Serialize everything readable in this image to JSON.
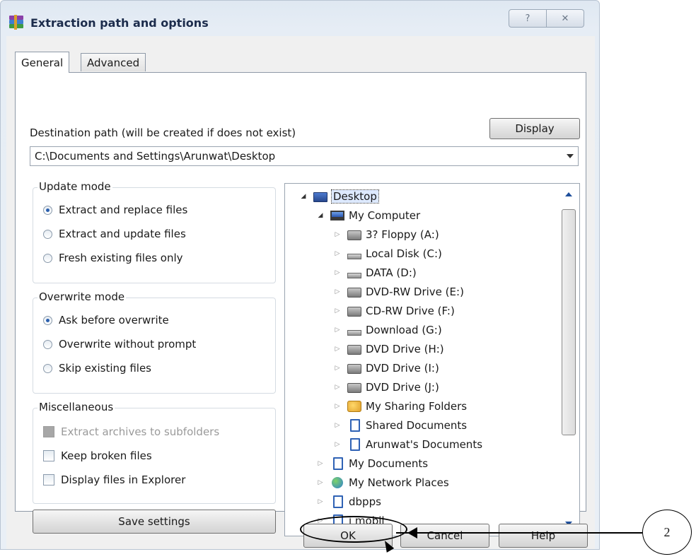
{
  "window": {
    "title": "Extraction path and options",
    "help_button": "?",
    "close_button": "✕"
  },
  "tabs": [
    {
      "label": "General",
      "selected": true
    },
    {
      "label": "Advanced",
      "selected": false
    }
  ],
  "destination": {
    "label": "Destination path (will be created if does not exist)",
    "display_button": "Display",
    "path_value": "C:\\Documents and Settings\\Arunwat\\Desktop"
  },
  "update_mode": {
    "title": "Update mode",
    "options": [
      {
        "label": "Extract and replace files",
        "selected": true
      },
      {
        "label": "Extract and update files",
        "selected": false
      },
      {
        "label": "Fresh existing files only",
        "selected": false
      }
    ]
  },
  "overwrite_mode": {
    "title": "Overwrite mode",
    "options": [
      {
        "label": "Ask before overwrite",
        "selected": true
      },
      {
        "label": "Overwrite without prompt",
        "selected": false
      },
      {
        "label": "Skip existing files",
        "selected": false
      }
    ]
  },
  "miscellaneous": {
    "title": "Miscellaneous",
    "options": [
      {
        "label": "Extract archives to subfolders",
        "enabled": false
      },
      {
        "label": "Keep broken files",
        "enabled": true
      },
      {
        "label": "Display files in Explorer",
        "enabled": true
      }
    ]
  },
  "save_settings_button": "Save settings",
  "tree": {
    "items": [
      {
        "label": "Desktop",
        "icon": "desktop-icon",
        "selected": true
      },
      {
        "label": "My Computer",
        "icon": "computer-icon"
      },
      {
        "label": "3? Floppy (A:)",
        "icon": "floppy-drive-icon"
      },
      {
        "label": "Local Disk (C:)",
        "icon": "hard-drive-icon"
      },
      {
        "label": "DATA (D:)",
        "icon": "hard-drive-icon"
      },
      {
        "label": "DVD-RW Drive (E:)",
        "icon": "dvd-drive-icon"
      },
      {
        "label": "CD-RW Drive (F:)",
        "icon": "cd-drive-icon"
      },
      {
        "label": "Download (G:)",
        "icon": "hard-drive-icon"
      },
      {
        "label": "DVD Drive (H:)",
        "icon": "dvd-drive-icon"
      },
      {
        "label": "DVD Drive (I:)",
        "icon": "dvd-drive-icon"
      },
      {
        "label": "DVD Drive (J:)",
        "icon": "dvd-drive-icon"
      },
      {
        "label": "My Sharing Folders",
        "icon": "sharing-folder-icon"
      },
      {
        "label": "Shared Documents",
        "icon": "folder-icon"
      },
      {
        "label": "Arunwat's Documents",
        "icon": "folder-icon"
      },
      {
        "label": "My Documents",
        "icon": "folder-icon"
      },
      {
        "label": "My Network Places",
        "icon": "network-icon"
      },
      {
        "label": "dbpps",
        "icon": "folder-icon"
      },
      {
        "label": "i mobil",
        "icon": "folder-icon"
      }
    ]
  },
  "footer": {
    "ok": "OK",
    "cancel": "Cancel",
    "help": "Help"
  },
  "callout": {
    "number": "2"
  }
}
